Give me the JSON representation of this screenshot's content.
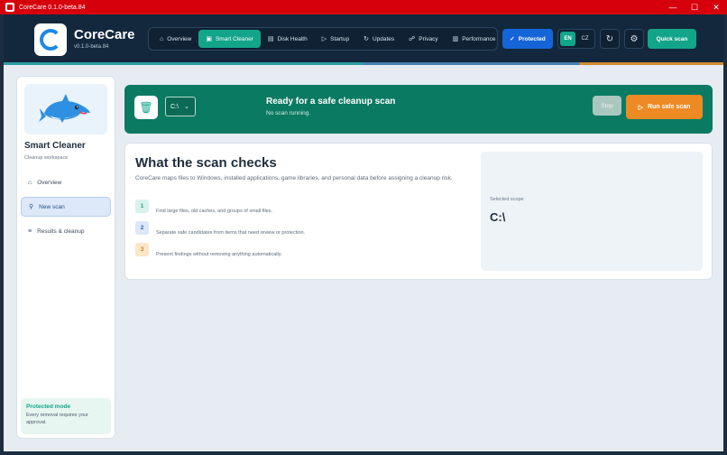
{
  "window": {
    "title": "CoreCare 0.1.0-beta.84",
    "controls": [
      "—",
      "☐",
      "✕"
    ]
  },
  "brand": {
    "name": "CoreCare",
    "version": "v0.1.0-beta.84"
  },
  "nav": {
    "tabs": [
      {
        "label": "Overview",
        "icon": "home-icon",
        "glyph": "⌂"
      },
      {
        "label": "Smart Cleaner",
        "icon": "broom-icon",
        "glyph": "▣"
      },
      {
        "label": "Disk Health",
        "icon": "disk-icon",
        "glyph": "▤"
      },
      {
        "label": "Startup",
        "icon": "play-icon",
        "glyph": "▷"
      },
      {
        "label": "Updates",
        "icon": "refresh-icon",
        "glyph": "↻"
      },
      {
        "label": "Privacy",
        "icon": "lock-icon",
        "glyph": "🔒"
      },
      {
        "label": "Performance",
        "icon": "gauge-icon",
        "glyph": "▥"
      }
    ],
    "active_tab": "Smart Cleaner"
  },
  "header_actions": {
    "protected_label": "Protected",
    "lang_en": "EN",
    "lang_cz": "CZ",
    "active_lang": "EN",
    "quick_scan_label": "Quick scan"
  },
  "sidebar": {
    "title": "Smart Cleaner",
    "subtitle": "Cleanup workspace",
    "items": [
      {
        "label": "Overview",
        "icon": "home-icon",
        "glyph": "⌂"
      },
      {
        "label": "New scan",
        "icon": "search-icon",
        "glyph": "⚲"
      },
      {
        "label": "Results & cleanup",
        "icon": "list-icon",
        "glyph": "≡"
      }
    ],
    "active_item": "New scan",
    "protected_mode": {
      "title": "Protected mode",
      "text": "Every removal requires your approval."
    }
  },
  "scan_bar": {
    "drive_value": "C:\\",
    "title": "Ready for a safe cleanup scan",
    "status": "No scan running.",
    "stop_label": "Stop",
    "run_label": "Run safe scan"
  },
  "checks": {
    "title": "What the scan checks",
    "intro": "CoreCare maps files to Windows, installed applications, game libraries, and personal data before assigning a cleanup risk.",
    "steps": [
      {
        "num": "1",
        "text": "Find large files, old caches, and groups of small files.",
        "color": "#d8f2ec",
        "text_color": "#13a58a"
      },
      {
        "num": "2",
        "text": "Separate safe candidates from items that need review or protection.",
        "color": "#dce7f8",
        "text_color": "#2a62b5"
      },
      {
        "num": "3",
        "text": "Present findings without removing anything automatically.",
        "color": "#fbe6c8",
        "text_color": "#d47a14"
      }
    ],
    "scope_label": "Selected scope",
    "scope_value": "C:\\"
  },
  "colors": {
    "brand_green": "#13a58a",
    "header_bg": "#13283d",
    "scan_bar_bg": "#0b7a62",
    "run_orange": "#ee8a23",
    "protected_blue": "#1565d8",
    "titlebar_red": "#d5000c"
  }
}
